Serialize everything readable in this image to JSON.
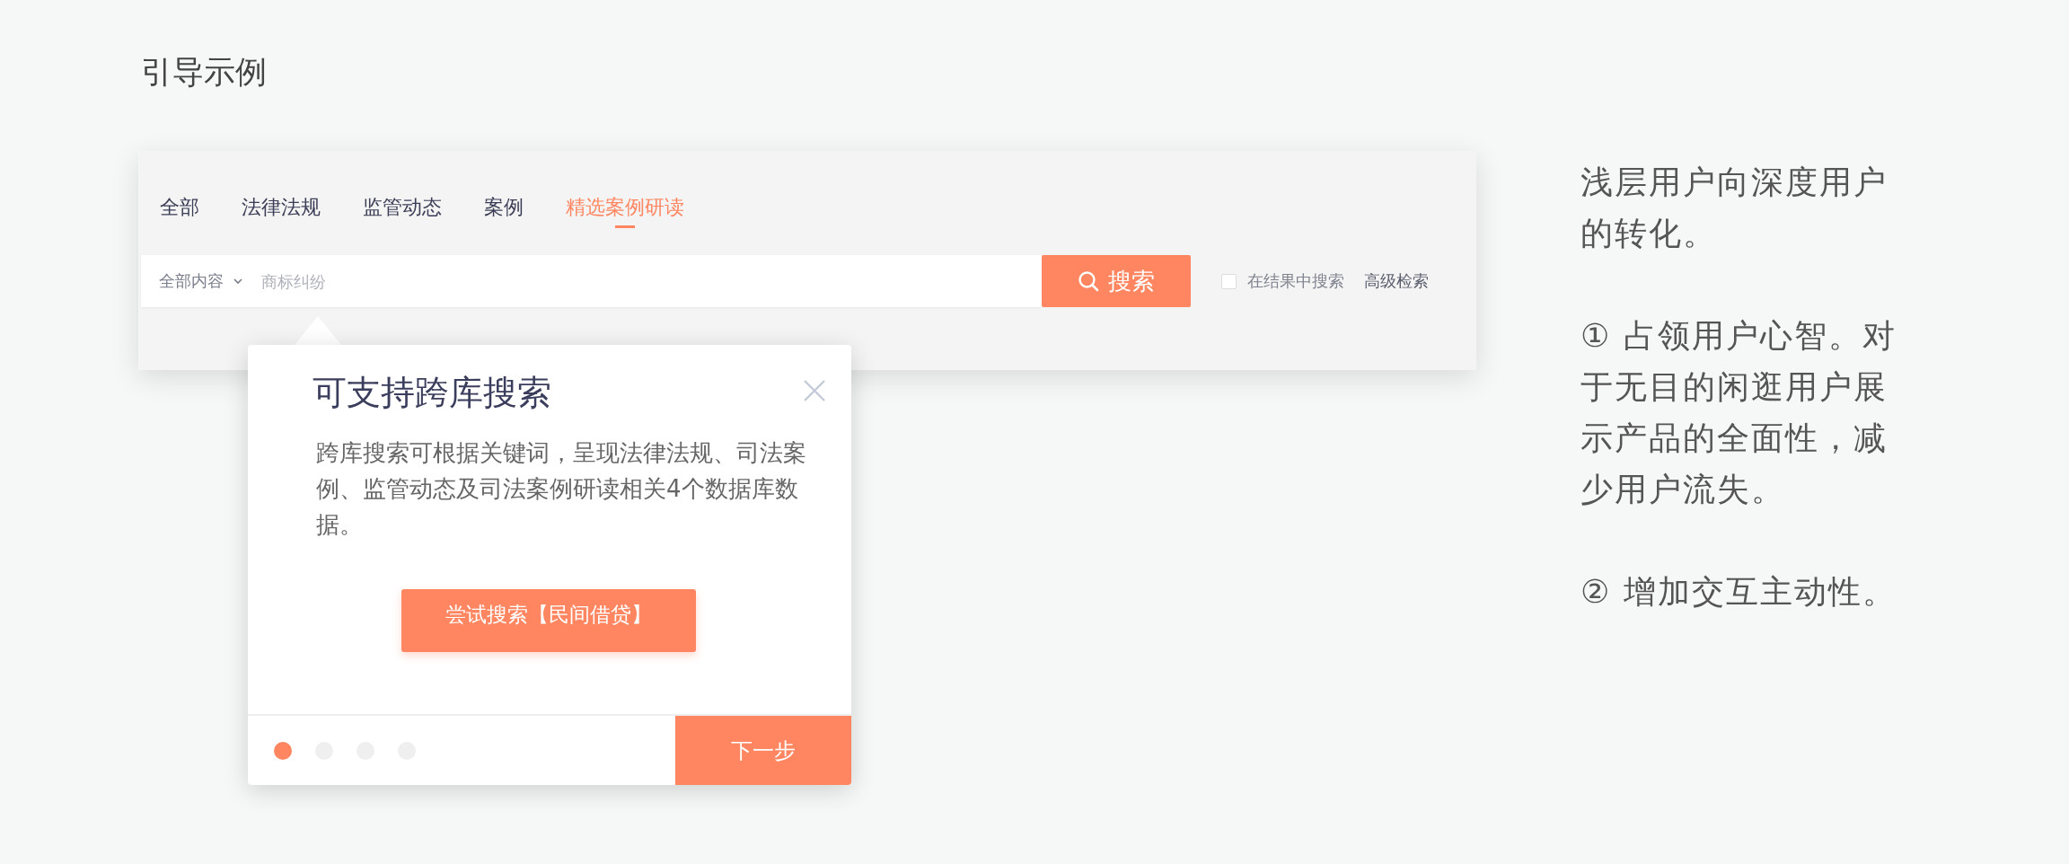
{
  "heading": "引导示例",
  "tabs": [
    {
      "label": "全部",
      "selected": false
    },
    {
      "label": "法律法规",
      "selected": false
    },
    {
      "label": "监管动态",
      "selected": false
    },
    {
      "label": "案例",
      "selected": false
    },
    {
      "label": "精选案例研读",
      "selected": true
    }
  ],
  "search": {
    "scope": "全部内容",
    "placeholder": "商标纠纷",
    "button": "搜索"
  },
  "within_results": {
    "label": "在结果中搜索",
    "checked": false
  },
  "advanced_search": "高级检索",
  "guide_popup": {
    "title": "可支持跨库搜索",
    "body": "跨库搜索可根据关键词，呈现法律法规、司法案例、监管动态及司法案例研读相关4个数据库数据。",
    "try_button": "尝试搜索【民间借贷】",
    "steps": [
      {
        "selected": true
      },
      {
        "selected": false
      },
      {
        "selected": false
      },
      {
        "selected": false
      }
    ],
    "next_button": "下一步"
  },
  "notes": [
    "浅层用户向深度用户的转化。",
    "① 占领用户心智。对于无目的闲逛用户展示产品的全面性，减少用户流失。",
    "② 增加交互主动性。"
  ]
}
